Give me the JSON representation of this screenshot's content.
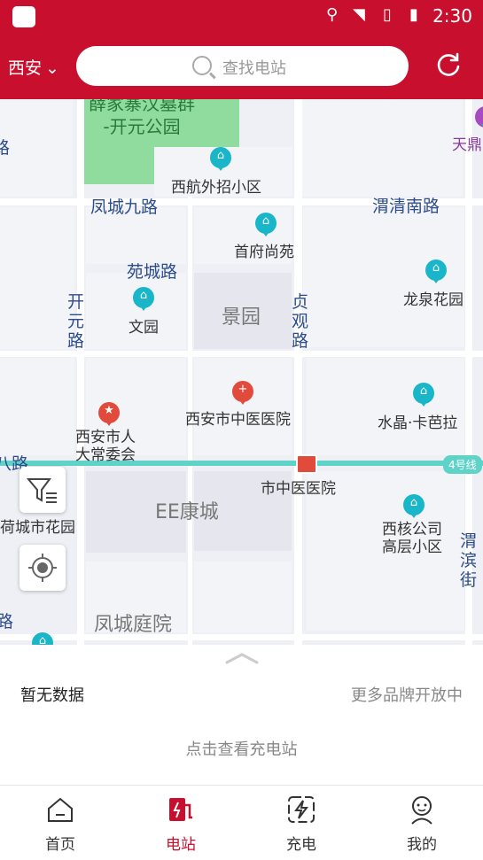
{
  "status_bar": {
    "time": "2:30"
  },
  "header": {
    "city": "西安",
    "search_placeholder": "查找电站"
  },
  "map": {
    "park_label": "薛家寨汉墓群\n-开元公园",
    "pois": [
      "西航外招小区",
      "首府尚苑",
      "文园",
      "龙泉花园",
      "西安市中医医院",
      "水晶·卡芭拉",
      "西安市人大常委会",
      "西核公司高层小区",
      "荷城市花园"
    ],
    "areas": [
      "景园",
      "EE康城",
      "凤城庭院"
    ],
    "roads": [
      "凤城九路",
      "渭清南路",
      "苑城路",
      "开元路",
      "贞观路",
      "渭滨街",
      "八路",
      "路"
    ],
    "metro_station": "市中医医院",
    "metro_line": "4号线",
    "edge_labels": [
      "天鼎"
    ],
    "metro_color": "#5fd3c8"
  },
  "panel": {
    "status": "暂无数据",
    "more": "更多品牌开放中",
    "tap_hint": "点击查看充电站"
  },
  "tabs": [
    {
      "label": "首页",
      "icon": "home-icon"
    },
    {
      "label": "电站",
      "icon": "charging-station-icon",
      "active": true
    },
    {
      "label": "充电",
      "icon": "charge-bolt-icon"
    },
    {
      "label": "我的",
      "icon": "profile-icon"
    }
  ],
  "colors": {
    "brand": "#c8102e",
    "poi": "#18b6c8"
  }
}
